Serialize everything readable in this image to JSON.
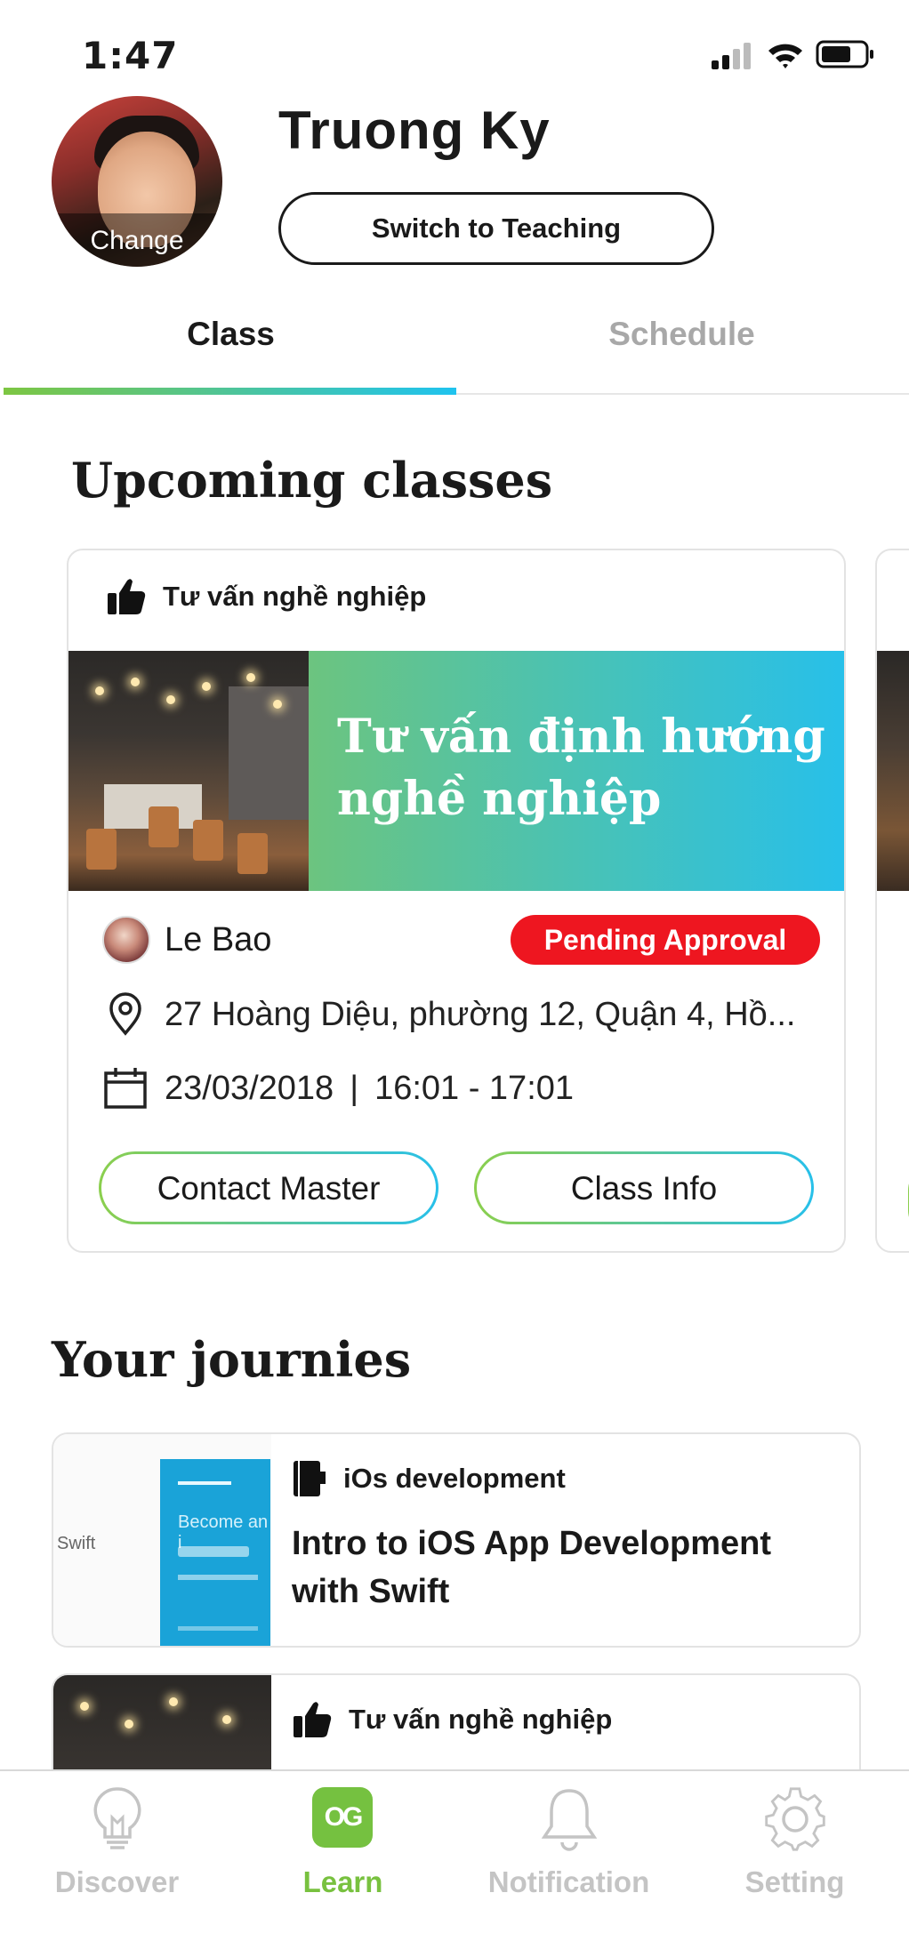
{
  "status_bar": {
    "time": "1:47"
  },
  "profile": {
    "name": "Truong Ky",
    "avatar_action": "Change",
    "switch_button": "Switch to Teaching"
  },
  "tabs": [
    {
      "label": "Class",
      "active": true
    },
    {
      "label": "Schedule",
      "active": false
    }
  ],
  "upcoming": {
    "title": "Upcoming classes",
    "card": {
      "category": "Tư vấn nghề nghiệp",
      "category_icon": "thumbs-up-icon",
      "banner_title": "Tư vấn định hướng nghề nghiệp",
      "master_name": "Le Bao",
      "status": "Pending Approval",
      "address": "27 Hoàng Diệu, phường 12, Quận 4, Hồ...",
      "date": "23/03/2018",
      "separator": "|",
      "time": "16:01 - 17:01",
      "contact_button": "Contact Master",
      "info_button": "Class Info"
    }
  },
  "journeys": {
    "title": "Your journies",
    "items": [
      {
        "category": "iOs development",
        "category_icon": "notebook-icon",
        "title": "Intro to iOS App Development with Swift",
        "thumb_caption": "Swift",
        "thumb_text": "Become an i"
      },
      {
        "category": "Tư vấn nghề nghiệp",
        "category_icon": "thumbs-up-icon",
        "title": ""
      }
    ]
  },
  "bottom_nav": [
    {
      "label": "Discover",
      "icon": "lightbulb-icon",
      "active": false
    },
    {
      "label": "Learn",
      "icon": "learn-logo-icon",
      "active": true,
      "icon_text": "OG"
    },
    {
      "label": "Notification",
      "icon": "bell-icon",
      "active": false
    },
    {
      "label": "Setting",
      "icon": "gear-icon",
      "active": false
    }
  ],
  "colors": {
    "accent_green": "#78c13f",
    "accent_blue": "#27c0ea",
    "badge_red": "#ee1620",
    "inactive_gray": "#c4c4c4"
  }
}
